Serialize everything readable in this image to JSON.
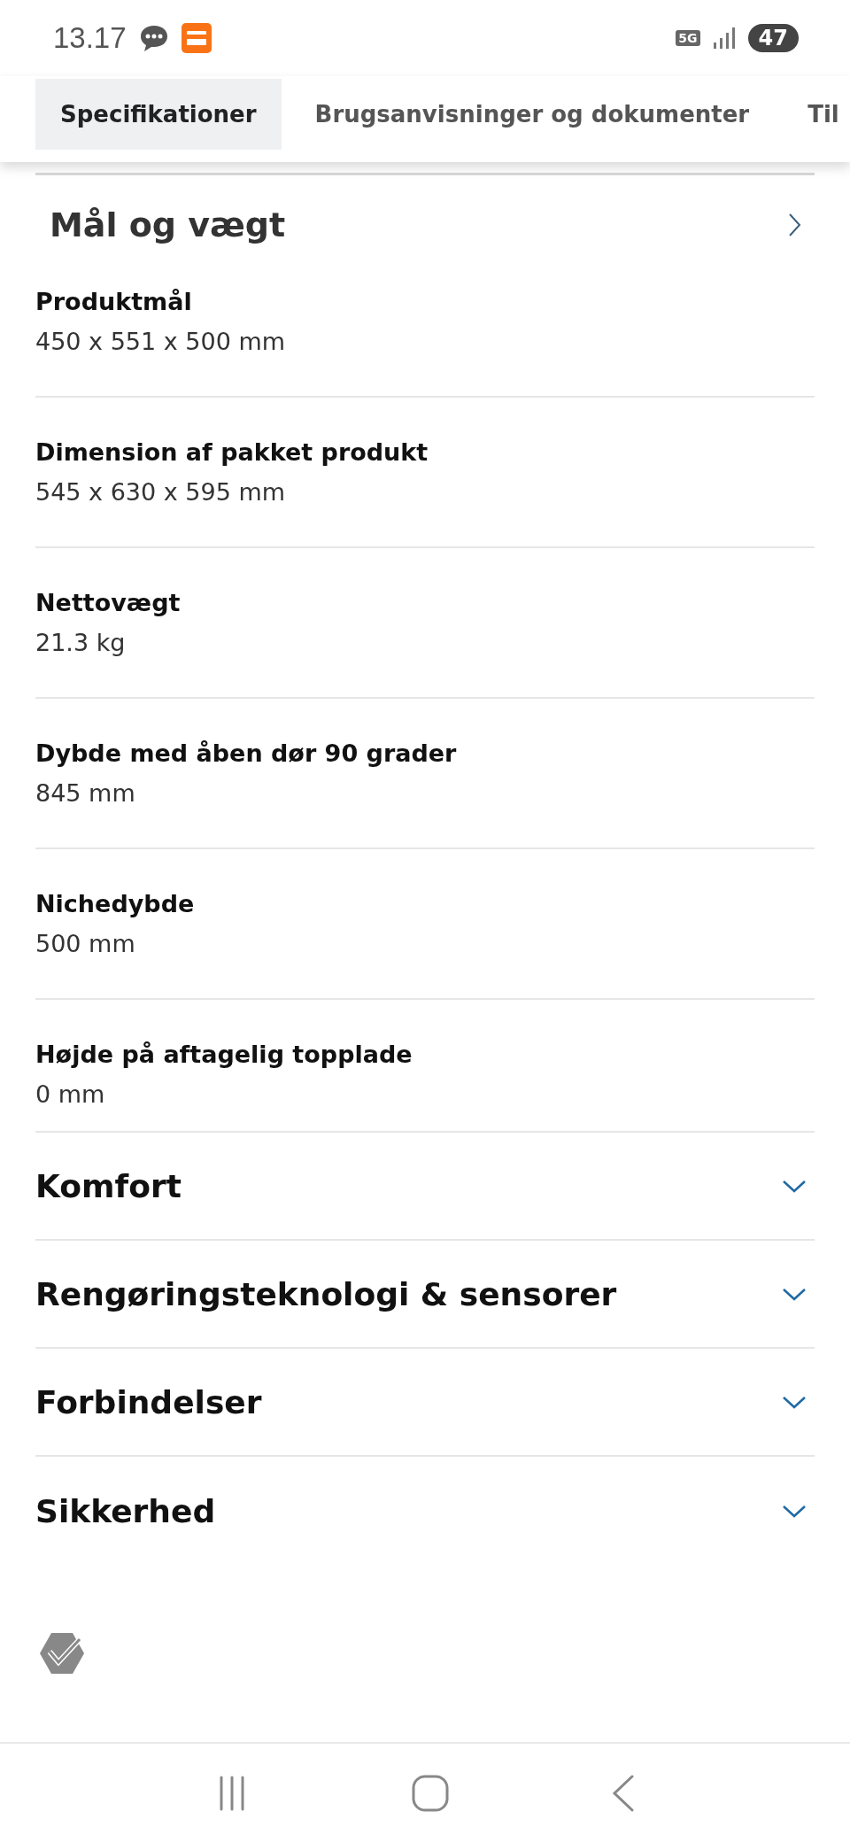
{
  "status_bar": {
    "time": "13.17",
    "network": "5G",
    "battery": "47"
  },
  "tabs": [
    {
      "label": "Specifikationer",
      "selected": true
    },
    {
      "label": "Brugsanvisninger og dokumenter",
      "selected": false
    },
    {
      "label": "Til",
      "selected": false
    }
  ],
  "group": {
    "title": "Mål og vægt",
    "expanded": true,
    "specs": [
      {
        "label": "Produktmål",
        "value": "450 x 551 x 500 mm"
      },
      {
        "label": "Dimension af pakket produkt",
        "value": "545 x 630 x 595 mm"
      },
      {
        "label": "Nettovægt",
        "value": "21.3 kg"
      },
      {
        "label": "Dybde med åben dør 90 grader",
        "value": "845 mm"
      },
      {
        "label": "Nichedybde",
        "value": "500 mm"
      },
      {
        "label": "Højde på aftagelig topplade",
        "value": "0 mm"
      }
    ]
  },
  "sections": [
    {
      "title": "Komfort",
      "expanded": false
    },
    {
      "title": "Rengøringsteknologi & sensorer",
      "expanded": false
    },
    {
      "title": "Forbindelser",
      "expanded": false
    },
    {
      "title": "Sikkerhed",
      "expanded": false
    }
  ]
}
